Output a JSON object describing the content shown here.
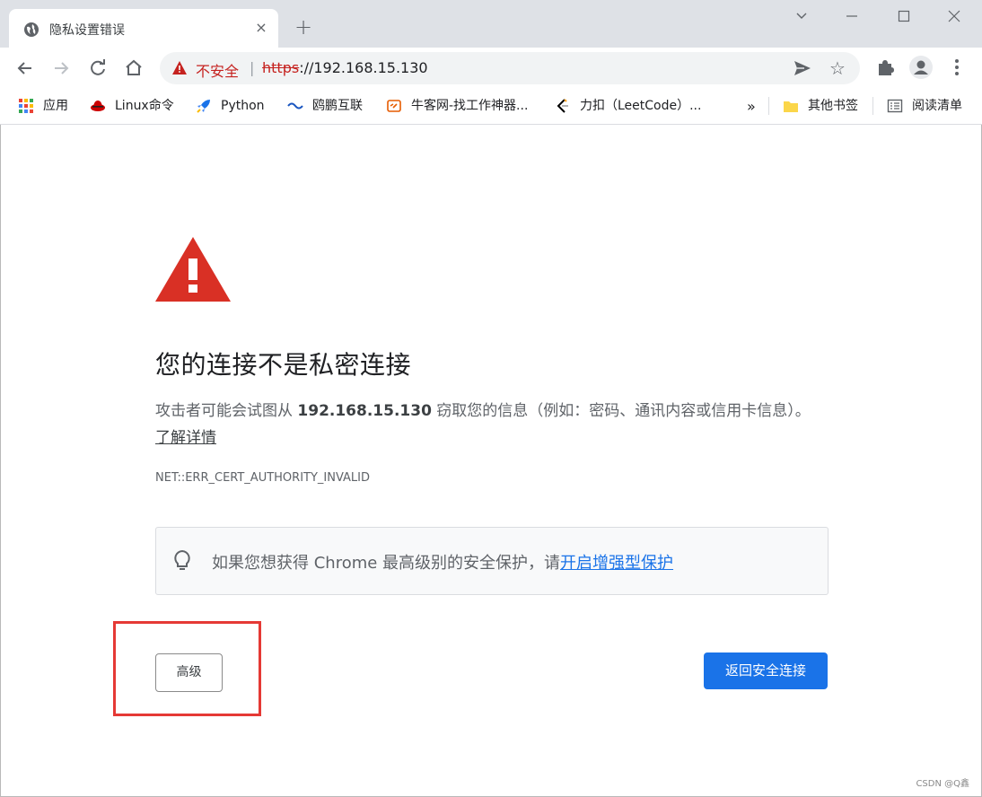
{
  "tab": {
    "title": "隐私设置错误",
    "close": "×"
  },
  "newtab": "+",
  "window": {
    "minimize": "—",
    "restore": "☐",
    "close": "✕",
    "collapse": "⌄"
  },
  "omnibox": {
    "not_secure": "不安全",
    "separator": "|",
    "scheme": "https",
    "rest": "://192.168.15.130",
    "star": "☆"
  },
  "bookmarks": {
    "items": [
      {
        "label": "应用",
        "icon": "apps-grid-icon"
      },
      {
        "label": "Linux命令",
        "icon": "redhat-icon"
      },
      {
        "label": "Python",
        "icon": "rocket-icon"
      },
      {
        "label": "鸥鹏互联",
        "icon": "site-icon"
      },
      {
        "label": "牛客网-找工作神器...",
        "icon": "nowcoder-icon"
      },
      {
        "label": "力扣（LeetCode）...",
        "icon": "leetcode-icon"
      }
    ],
    "more": "»",
    "other": "其他书签",
    "reading": "阅读清单"
  },
  "content": {
    "heading": "您的连接不是私密连接",
    "desc_prefix": "攻击者可能会试图从 ",
    "host": "192.168.15.130",
    "desc_suffix": " 窃取您的信息（例如：密码、通讯内容或信用卡信息）。",
    "learn_more": "了解详情",
    "error_code": "NET::ERR_CERT_AUTHORITY_INVALID",
    "enhanced_text": "如果您想获得 Chrome 最高级别的安全保护，请",
    "enhanced_link": "开启增强型保护",
    "advanced_label": "高级",
    "back_label": "返回安全连接"
  },
  "watermark": "CSDN @Q鑫",
  "colors": {
    "danger": "#d93025",
    "accent": "#1a73e8",
    "highlight": "#e53935"
  }
}
